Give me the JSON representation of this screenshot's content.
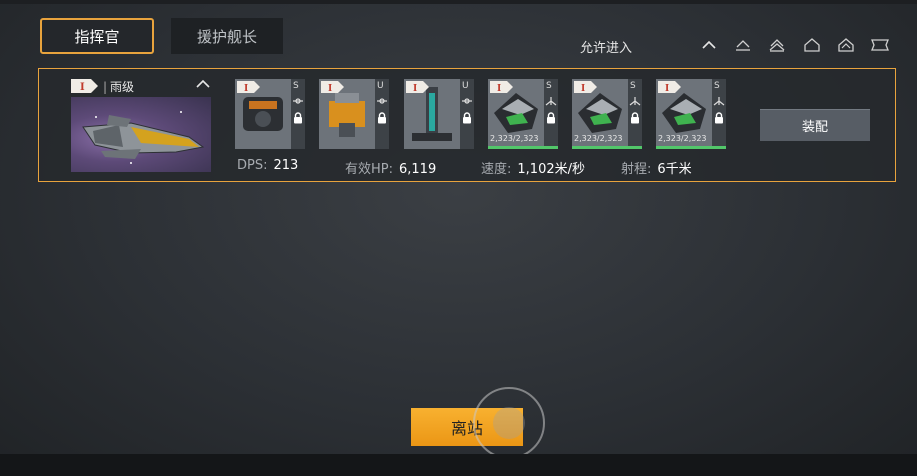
{
  "tabs": {
    "commander": "指挥官",
    "escort": "援护舰长"
  },
  "allow_entry": {
    "label": "允许进入",
    "filters": [
      "chevron-icon",
      "tier1-icon",
      "tier2-icon",
      "tier3-icon",
      "tier4-icon",
      "tier5-icon"
    ]
  },
  "ship": {
    "tier": "I",
    "name": "雨级"
  },
  "modules": [
    {
      "slot": "S",
      "art": "cannon-turret-icon",
      "role": "link-icon"
    },
    {
      "slot": "U",
      "art": "yellow-device-icon",
      "role": "link-icon"
    },
    {
      "slot": "U",
      "art": "tower-device-icon",
      "role": "link-icon"
    },
    {
      "slot": "S",
      "art": "fighter-icon",
      "role": "aircraft-icon",
      "hp": "2,323/2,323",
      "hp_ratio": 1.0
    },
    {
      "slot": "S",
      "art": "fighter-icon",
      "role": "aircraft-icon",
      "hp": "2,323/2,323",
      "hp_ratio": 1.0
    },
    {
      "slot": "S",
      "art": "fighter-icon",
      "role": "aircraft-icon",
      "hp": "2,323/2,323",
      "hp_ratio": 1.0
    }
  ],
  "equip_label": "装配",
  "stats": {
    "dps_label": "DPS:",
    "dps": "213",
    "hp_label": "有效HP:",
    "hp": "6,119",
    "speed_label": "速度:",
    "speed": "1,102米/秒",
    "range_label": "射程:",
    "range": "6千米"
  },
  "depart_label": "离站",
  "colors": {
    "accent": "#e8a33d",
    "button_orange": "#f5a623",
    "hp_green": "#52c76a"
  }
}
